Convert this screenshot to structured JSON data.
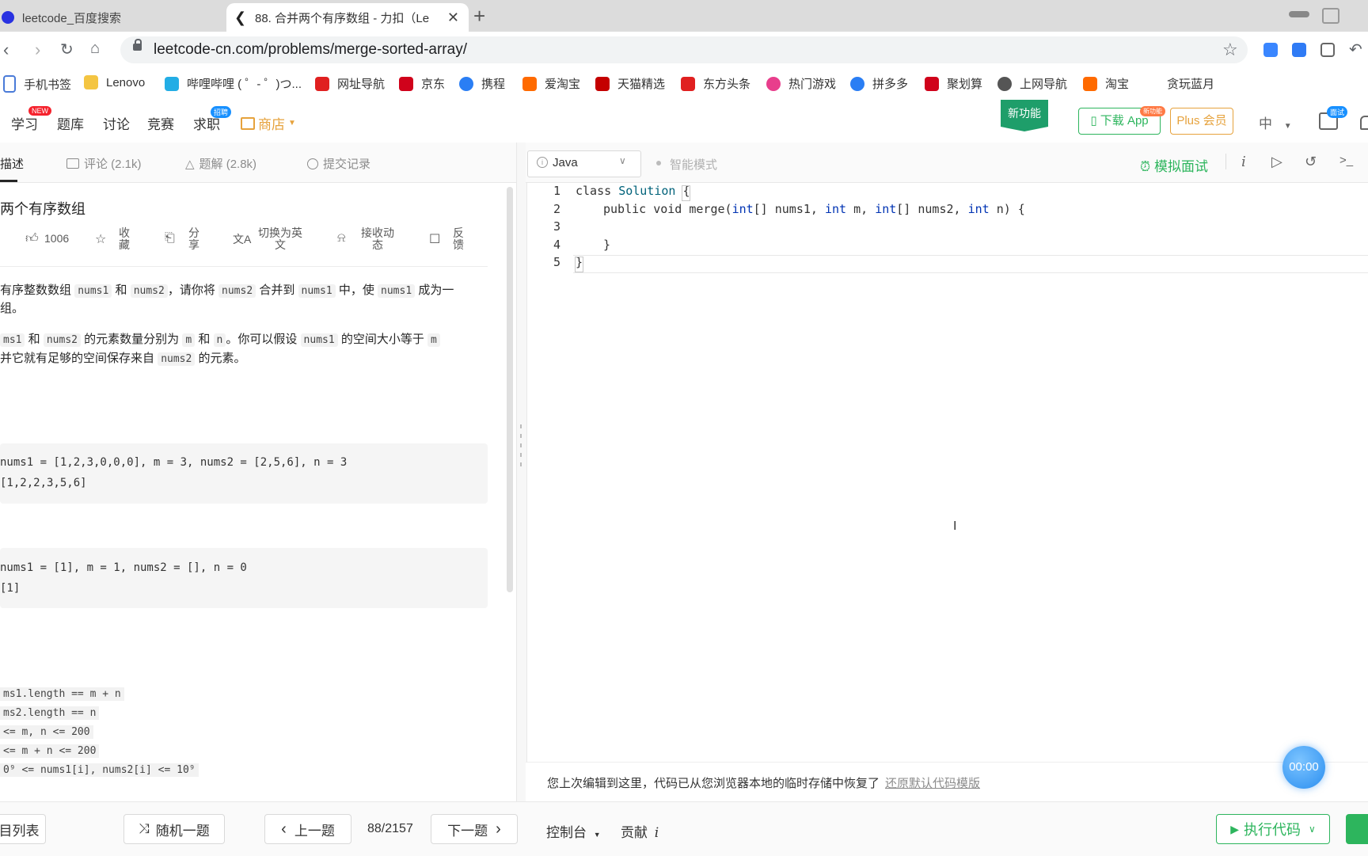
{
  "browser": {
    "tabs": [
      {
        "title": "leetcode_百度搜索",
        "active": false
      },
      {
        "title": "88. 合并两个有序数组 - 力扣（Le",
        "active": true
      }
    ],
    "new_tab_glyph": "+",
    "url": "leetcode-cn.com/problems/merge-sorted-array/",
    "bookmarks": [
      "手机书签",
      "Lenovo",
      "哔哩哔哩 ( ゜- ゜)つ...",
      "网址导航",
      "京东",
      "携程",
      "爱淘宝",
      "天猫精选",
      "东方头条",
      "热门游戏",
      "拼多多",
      "聚划算",
      "上网导航",
      "淘宝",
      "贪玩蓝月"
    ]
  },
  "site_nav": {
    "items": [
      "学习",
      "题库",
      "讨论",
      "竞赛",
      "求职",
      "商店"
    ],
    "badge_new": "NEW",
    "badge_job": "招聘",
    "new_feature": "新功能",
    "download_app": "下载 App",
    "download_badge": "新功能",
    "plus": "Plus 会员",
    "lang": "中",
    "interview_badge": "面试"
  },
  "left_tabs": [
    {
      "label": "描述",
      "active": true
    },
    {
      "label": "评论 (2.1k)",
      "active": false
    },
    {
      "label": "题解 (2.8k)",
      "active": false
    },
    {
      "label": "提交记录",
      "active": false
    }
  ],
  "problem": {
    "title": "两个有序数组",
    "likes": "1006",
    "actions": {
      "collect_a": "收",
      "collect_b": "藏",
      "share_a": "分",
      "share_b": "享",
      "translate_a": "切换为英",
      "translate_b": "文",
      "notify_a": "接收动",
      "notify_b": "态",
      "feedback_a": "反",
      "feedback_b": "馈"
    },
    "para1": {
      "t1": "有序整数数组",
      "c1": "nums1",
      "t2": "和",
      "c2": "nums2",
      "t3": "，请你将",
      "c3": "nums2",
      "t4": "合并到",
      "c4": "nums1",
      "t5": "中，使",
      "c5": "nums1",
      "t6": "成为一",
      "line2": "组。"
    },
    "para2": {
      "c1": "ms1",
      "t1": "和",
      "c2": "nums2",
      "t2": "的元素数量分别为",
      "c3": "m",
      "t3": "和",
      "c4": "n",
      "t4": "。你可以假设",
      "c5": "nums1",
      "t5": "的空间大小等于",
      "c6": "m",
      "l2a": "并它就有足够的空间保存来自",
      "l2c": "nums2",
      "l2b": "的元素。"
    },
    "example1": {
      "input": "nums1 = [1,2,3,0,0,0], m = 3, nums2 = [2,5,6], n = 3",
      "output": "[1,2,2,3,5,6]"
    },
    "example2": {
      "input": "nums1 = [1], m = 1, nums2 = [], n = 0",
      "output": "[1]"
    },
    "constraints": [
      "ms1.length == m + n",
      "ms2.length == n",
      "<= m, n <= 200",
      "<= m + n <= 200",
      "0⁹ <= nums1[i], nums2[i] <= 10⁹"
    ]
  },
  "editor": {
    "language": "Java",
    "info_glyph": "i",
    "smart_mode": "智能模式",
    "mock_interview": "模拟面试",
    "line_numbers": [
      "1",
      "2",
      "3",
      "4",
      "5"
    ],
    "code": {
      "l1_kw": "class",
      "l1_type": "Solution",
      "l1_rest": " {",
      "l2_kw1": "public",
      "l2_kw2": "void",
      "l2_name": " merge(",
      "l2_t1": "int",
      "l2_a": "[] nums1, ",
      "l2_t2": "int",
      "l2_b": " m, ",
      "l2_t3": "int",
      "l2_c": "[] nums2, ",
      "l2_t4": "int",
      "l2_d": " n) {",
      "l4": "}",
      "l5": "}"
    },
    "restore_text": "您上次编辑到这里，代码已从您浏览器本地的临时存储中恢复了",
    "restore_link": "还原默认代码模版",
    "timer": "00:00"
  },
  "bottom": {
    "list": "目列表",
    "random": "随机一题",
    "prev": "上一题",
    "page": "88/2157",
    "next": "下一题",
    "console": "控制台",
    "contribute": "贡献",
    "contribute_i": "i",
    "run": "执行代码"
  },
  "colors": {
    "accent_green": "#2db55d",
    "orange": "#e6a23c",
    "timer_blue": "#2a8ef0"
  }
}
